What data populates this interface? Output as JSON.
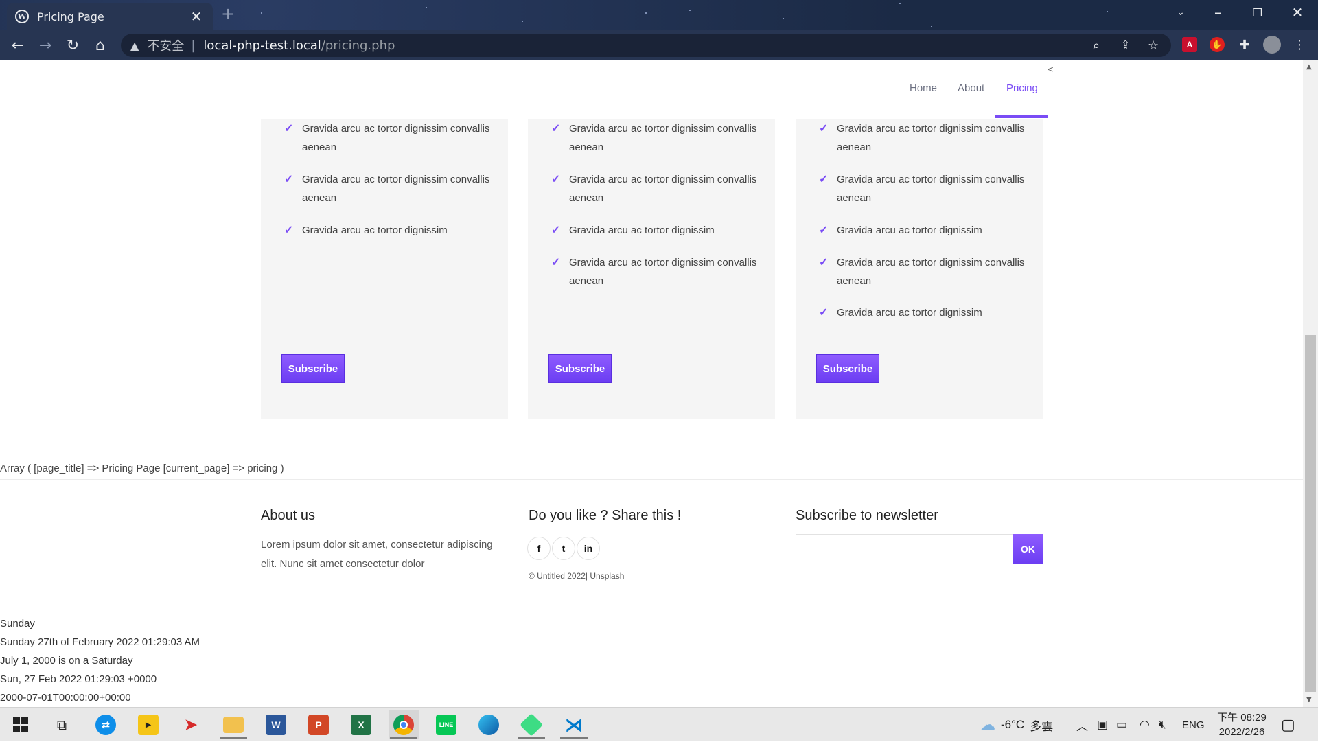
{
  "browser": {
    "tab_title": "Pricing Page",
    "tab_close": "✕",
    "new_tab": "+",
    "insecure_label": "不安全",
    "url_separator": "|",
    "url_host": "local-php-test.local",
    "url_path": "/pricing.php"
  },
  "nav": {
    "collapse_mark": "<",
    "items": [
      {
        "label": "Home"
      },
      {
        "label": "About"
      },
      {
        "label": "Pricing"
      }
    ]
  },
  "cards": [
    {
      "features": [
        "Gravida arcu ac tortor dignissim convallis aenean",
        "Gravida arcu ac tortor dignissim convallis aenean",
        "Gravida arcu ac tortor dignissim"
      ],
      "button": "Subscribe"
    },
    {
      "features": [
        "Gravida arcu ac tortor dignissim convallis aenean",
        "Gravida arcu ac tortor dignissim convallis aenean",
        "Gravida arcu ac tortor dignissim",
        "Gravida arcu ac tortor dignissim convallis aenean"
      ],
      "button": "Subscribe"
    },
    {
      "features": [
        "Gravida arcu ac tortor dignissim convallis aenean",
        "Gravida arcu ac tortor dignissim convallis aenean",
        "Gravida arcu ac tortor dignissim",
        "Gravida arcu ac tortor dignissim convallis aenean",
        "Gravida arcu ac tortor dignissim"
      ],
      "button": "Subscribe"
    }
  ],
  "debug_output": "Array ( [page_title] => Pricing Page [current_page] => pricing )",
  "footer": {
    "about_title": "About us",
    "about_text": "Lorem ipsum dolor sit amet, consectetur adipiscing elit. Nunc sit amet consectetur dolor",
    "share_title": "Do you like ? Share this !",
    "social": [
      "f",
      "t",
      "in"
    ],
    "copyright": "© Untitled 2022|",
    "copyright_link": "Unsplash",
    "newsletter_title": "Subscribe to newsletter",
    "newsletter_button": "OK",
    "newsletter_value": ""
  },
  "dates": [
    "Sunday",
    "Sunday 27th of February 2022 01:29:03 AM",
    "July 1, 2000 is on a Saturday",
    "Sun, 27 Feb 2022 01:29:03 +0000",
    "2000-07-01T00:00:00+00:00"
  ],
  "taskbar": {
    "weather_temp": "-6°C",
    "weather_desc": "多雲",
    "language": "ENG",
    "time": "下午 08:29",
    "date": "2022/2/26",
    "apps": [
      "start",
      "task-view",
      "teamviewer",
      "potplayer",
      "git-app",
      "file-explorer",
      "word",
      "powerpoint",
      "excel",
      "chrome",
      "line",
      "edge",
      "android-studio",
      "vscode"
    ]
  },
  "colors": {
    "accent": "#7a4cf5",
    "card_bg": "#f5f5f5",
    "browser_frame": "#1b2a45"
  }
}
